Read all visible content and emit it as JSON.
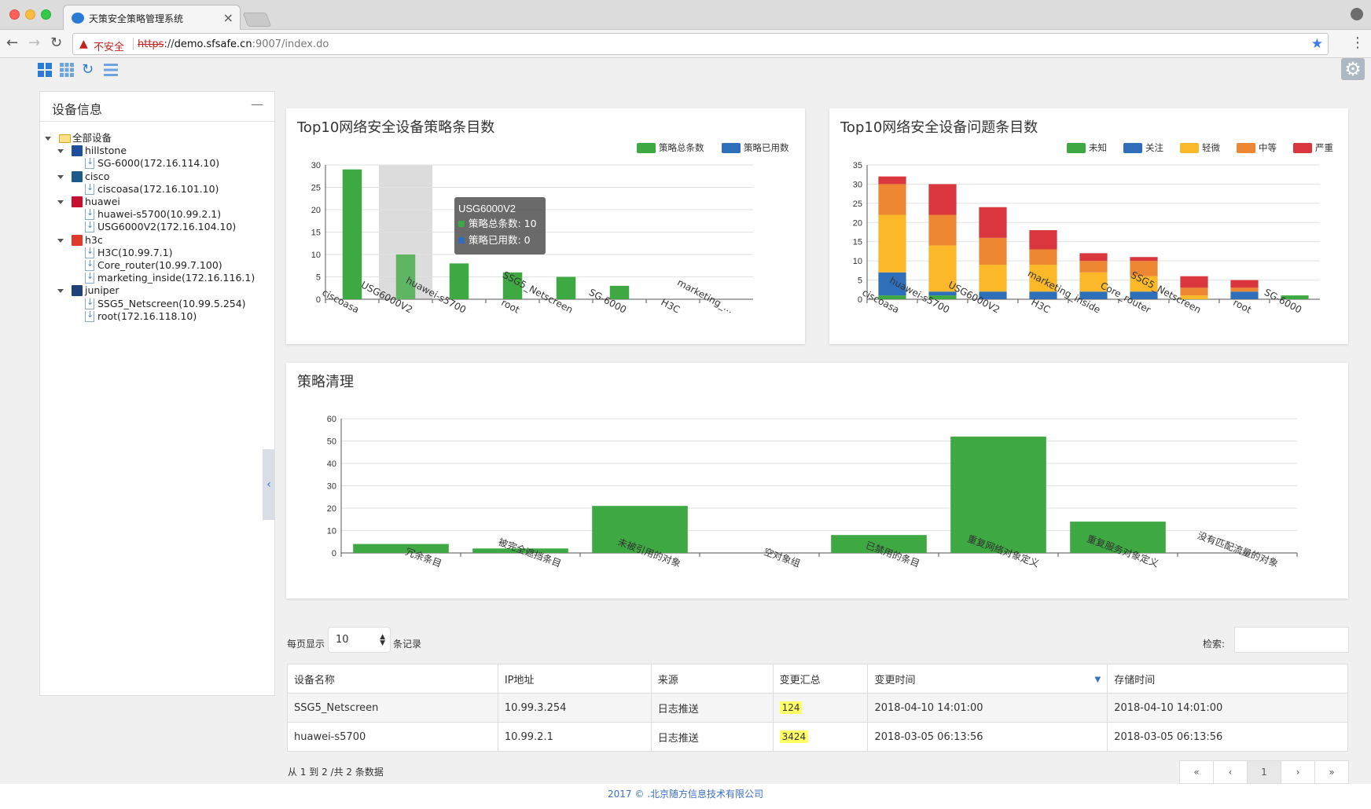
{
  "browser": {
    "tab_title": "天策安全策略管理系统",
    "insecure_label": "不安全",
    "url_scheme": "https",
    "url_rest": "://",
    "url_host": "demo.sfsafe.cn",
    "url_path": ":9007/index.do",
    "icons": [
      "favicon-icon",
      "close-icon",
      "back-icon",
      "forward-icon",
      "reload-icon",
      "warning-icon",
      "star-icon",
      "menu-icon",
      "profile-icon"
    ]
  },
  "app_toolbar": {
    "icons": [
      "layout-grid-icon",
      "layout-tiles-icon",
      "refresh-icon",
      "list-icon",
      "gear-icon"
    ]
  },
  "sidebar": {
    "title": "设备信息",
    "collapse_label": "—",
    "root": "全部设备",
    "groups": [
      {
        "label": "hillstone",
        "icon_color": "#1d4f9e",
        "devices": [
          "SG-6000(172.16.114.10)"
        ]
      },
      {
        "label": "cisco",
        "icon_color": "#1c5a8a",
        "devices": [
          "ciscoasa(172.16.101.10)"
        ]
      },
      {
        "label": "huawei",
        "icon_color": "#c8102e",
        "devices": [
          "huawei-s5700(10.99.2.1)",
          "USG6000V2(172.16.104.10)"
        ]
      },
      {
        "label": "h3c",
        "icon_color": "#e03a2b",
        "devices": [
          "H3C(10.99.7.1)",
          "Core_router(10.99.7.100)",
          "marketing_inside(172.16.116.1)"
        ]
      },
      {
        "label": "juniper",
        "icon_color": "#20407a",
        "devices": [
          "SSG5_Netscreen(10.99.5.254)",
          "root(172.16.118.10)"
        ]
      }
    ]
  },
  "chart_data": [
    {
      "type": "bar",
      "title": "Top10网络安全设备策略条目数",
      "categories": [
        "ciscoasa",
        "USG6000V2",
        "huawei-s5700",
        "root",
        "SSG5_Netscreen",
        "SG-6000",
        "H3C",
        "marketing_..."
      ],
      "series": [
        {
          "name": "策略总条数",
          "values": [
            29,
            10,
            8,
            6,
            5,
            3,
            0,
            0
          ],
          "color": "#3ea843"
        },
        {
          "name": "策略已用数",
          "values": [
            0,
            0,
            0,
            0,
            0,
            0,
            0,
            0
          ],
          "color": "#2f6fba"
        }
      ],
      "ylim": [
        0,
        30
      ],
      "yticks": [
        0,
        5,
        10,
        15,
        20,
        25,
        30
      ],
      "legend": "top-right",
      "highlight_index": 1,
      "tooltip": {
        "title": "USG6000V2",
        "lines": [
          "策略总条数: 10",
          "策略已用数: 0"
        ]
      }
    },
    {
      "type": "bar",
      "stacked": true,
      "title": "Top10网络安全设备问题条目数",
      "categories": [
        "ciscoasa",
        "huawei-s5700",
        "USG6000V2",
        "H3C",
        "marketing_inside",
        "Core_router",
        "SSG5_Netscreen",
        "root",
        "SG-6000"
      ],
      "series": [
        {
          "name": "未知",
          "values": [
            1,
            1,
            0,
            0,
            0,
            0,
            0,
            0,
            1
          ],
          "color": "#3ea843"
        },
        {
          "name": "关注",
          "values": [
            6,
            1,
            2,
            2,
            2,
            2,
            0,
            2,
            0
          ],
          "color": "#2f6fba"
        },
        {
          "name": "轻微",
          "values": [
            15,
            12,
            7,
            7,
            5,
            4,
            1,
            0,
            0
          ],
          "color": "#fbb829"
        },
        {
          "name": "中等",
          "values": [
            8,
            8,
            7,
            4,
            3,
            4,
            2,
            1,
            0
          ],
          "color": "#ee8733"
        },
        {
          "name": "严重",
          "values": [
            2,
            8,
            8,
            5,
            2,
            1,
            3,
            2,
            0
          ],
          "color": "#d9363e"
        }
      ],
      "ylim": [
        0,
        35
      ],
      "yticks": [
        0,
        5,
        10,
        15,
        20,
        25,
        30,
        35
      ],
      "legend": "top-right"
    },
    {
      "type": "bar",
      "title": "策略清理",
      "categories": [
        "冗余条目",
        "被完全遮挡条目",
        "未被引用的对象",
        "空对象组",
        "已禁用的条目",
        "重复网络对象定义",
        "重复服务对象定义",
        "没有匹配流量的对象"
      ],
      "series": [
        {
          "values": [
            4,
            2,
            21,
            0,
            8,
            52,
            14,
            0
          ],
          "color": "#3ea843"
        }
      ],
      "ylim": [
        0,
        60
      ],
      "yticks": [
        0,
        10,
        20,
        30,
        40,
        50,
        60
      ]
    }
  ],
  "table": {
    "page_len_label": "每页显示",
    "page_len_value": "10",
    "records_label": "条记录",
    "search_label": "检索:",
    "columns": [
      "设备名称",
      "IP地址",
      "来源",
      "变更汇总",
      "变更时间",
      "存储时间"
    ],
    "sort_indicator": "▼",
    "rows": [
      [
        "SSG5_Netscreen",
        "10.99.3.254",
        "日志推送",
        "124",
        "2018-04-10 14:01:00",
        "2018-04-10 14:01:00"
      ],
      [
        "huawei-s5700",
        "10.99.2.1",
        "日志推送",
        "3424",
        "2018-03-05 06:13:56",
        "2018-03-05 06:13:56"
      ]
    ],
    "info": "从 1 到 2 /共 2 条数据",
    "pagination": [
      "«",
      "‹",
      "1",
      "›",
      "»"
    ],
    "active_page": "1"
  },
  "footer": "2017 © .北京随方信息技术有限公司"
}
